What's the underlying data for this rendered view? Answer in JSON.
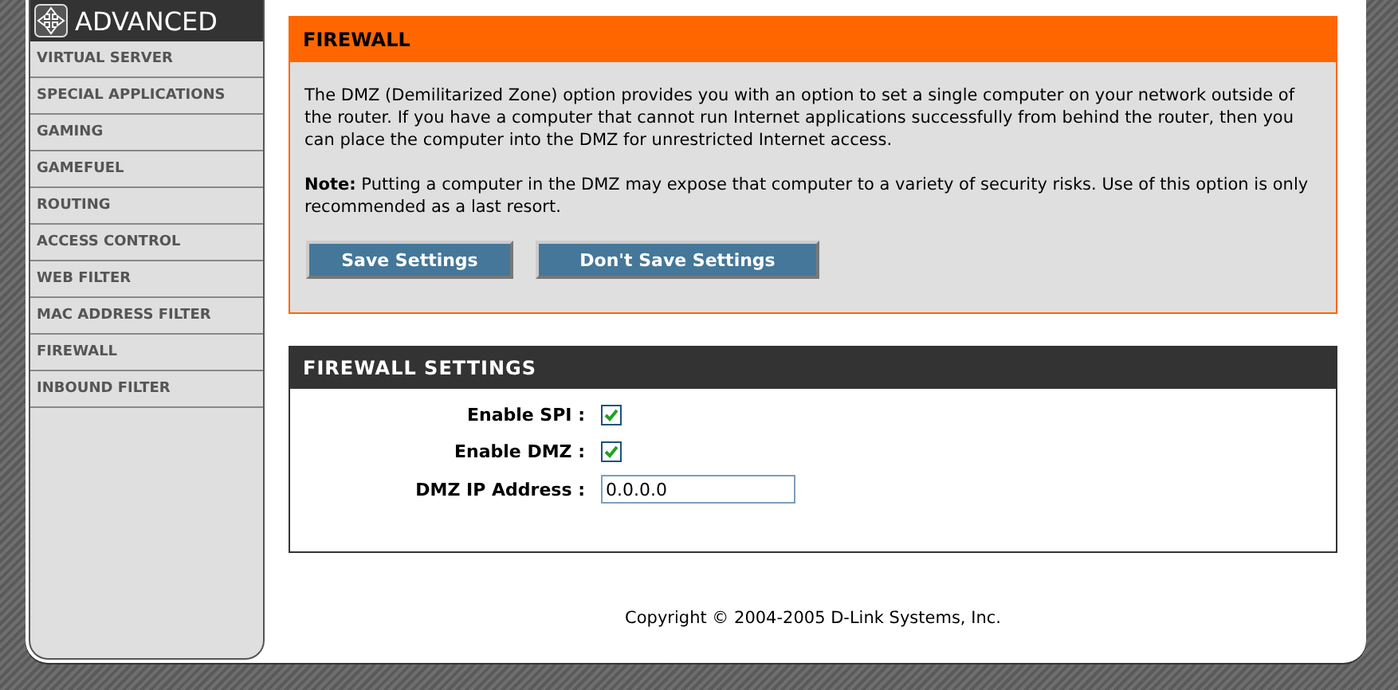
{
  "sidebar": {
    "title": "ADVANCED",
    "items": [
      {
        "label": "VIRTUAL SERVER"
      },
      {
        "label": "SPECIAL APPLICATIONS"
      },
      {
        "label": "GAMING"
      },
      {
        "label": "GAMEFUEL"
      },
      {
        "label": "ROUTING"
      },
      {
        "label": "ACCESS CONTROL"
      },
      {
        "label": "WEB FILTER"
      },
      {
        "label": "MAC ADDRESS FILTER"
      },
      {
        "label": "FIREWALL"
      },
      {
        "label": "INBOUND FILTER"
      }
    ]
  },
  "intro": {
    "title": "FIREWALL",
    "paragraphs": [
      "The DMZ (Demilitarized Zone) option provides you with an option to set a single computer on your network outside of the router. If you have a computer that cannot run Internet applications successfully from behind the router, then you can place the computer into the DMZ for unrestricted Internet access.",
      "**Note:** Putting a computer in the DMZ may expose that computer to a variety of security risks. Use of this option is only recommended as a last resort."
    ],
    "buttons": [
      "Save Settings",
      "Don't Save Settings"
    ]
  },
  "settings": {
    "title": "FIREWALL SETTINGS",
    "fields": [
      {
        "kind": "checkbox",
        "label": "Enable SPI :",
        "checked": true
      },
      {
        "kind": "checkbox",
        "label": "Enable DMZ :",
        "checked": true
      },
      {
        "kind": "text",
        "label": "DMZ IP Address :",
        "value": "0.0.0.0"
      }
    ]
  },
  "footer": {
    "copyright": "Copyright © 2004-2005 D-Link Systems, Inc."
  }
}
